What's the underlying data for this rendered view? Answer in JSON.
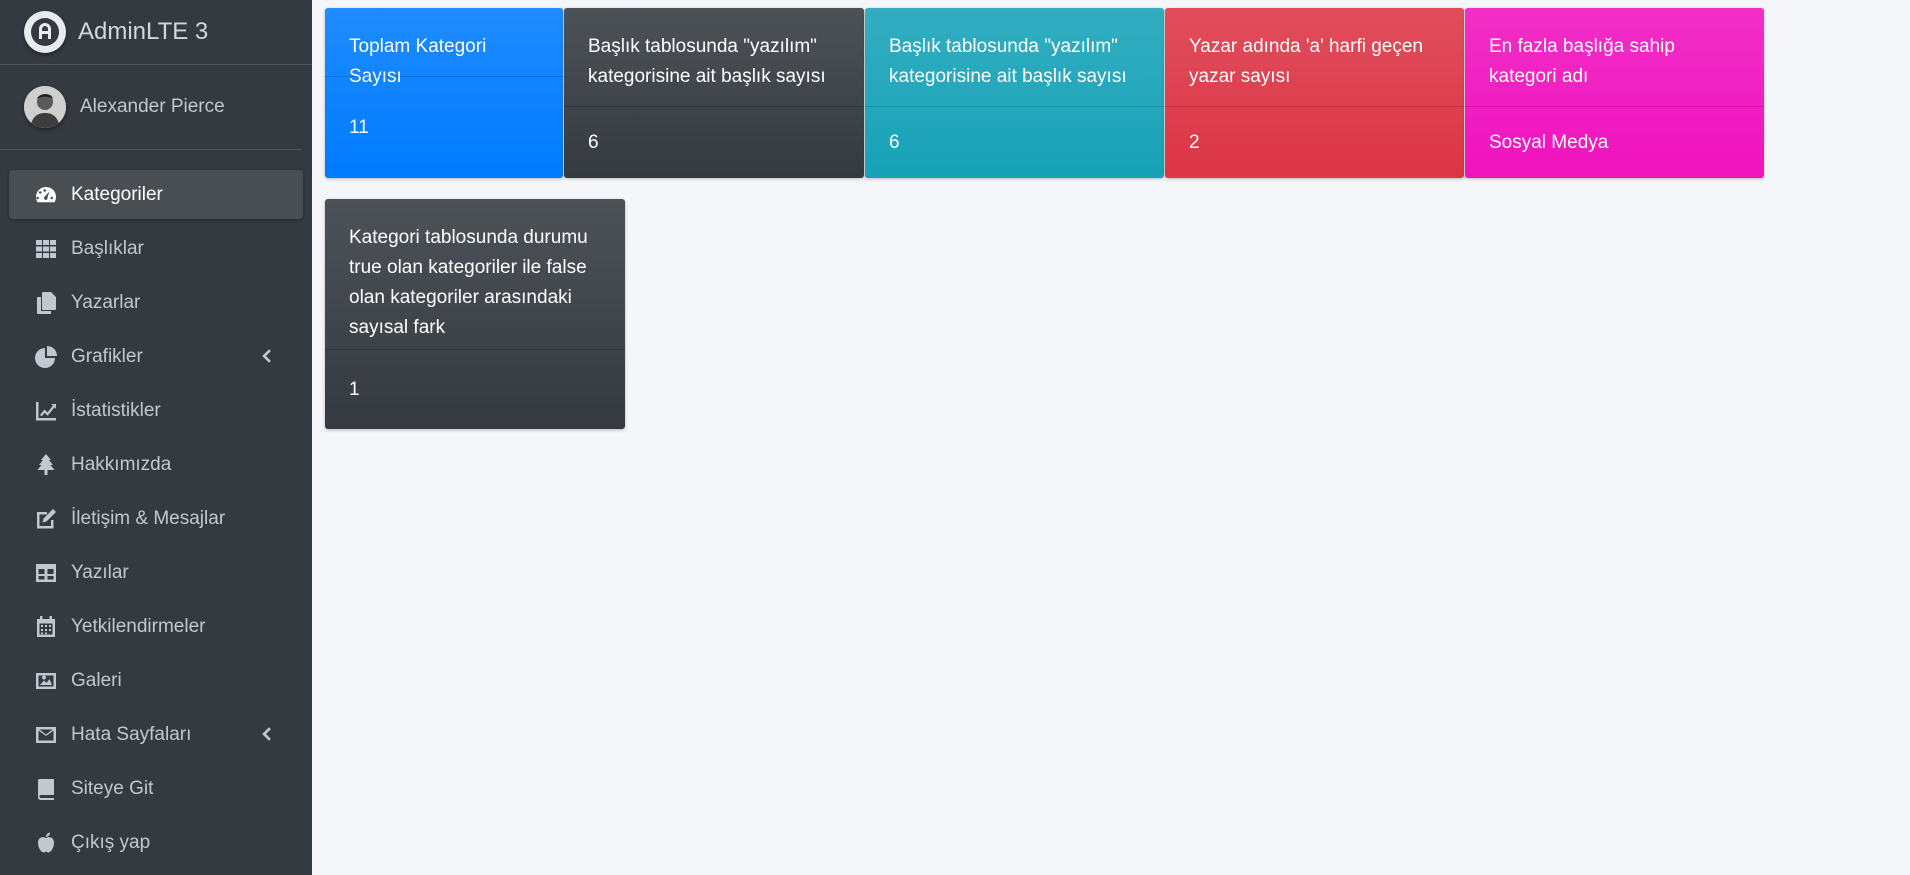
{
  "brand": {
    "title": "AdminLTE 3",
    "logo_icon": "adminlte-logo-icon"
  },
  "user": {
    "name": "Alexander Pierce"
  },
  "sidebar": {
    "items": [
      {
        "label": "Kategoriler",
        "icon": "dashboard-icon",
        "active": true
      },
      {
        "label": "Başlıklar",
        "icon": "grid-icon"
      },
      {
        "label": "Yazarlar",
        "icon": "copy-icon"
      },
      {
        "label": "Grafikler",
        "icon": "pie-chart-icon",
        "has_chevron": true
      },
      {
        "label": "İstatistikler",
        "icon": "line-chart-icon"
      },
      {
        "label": "Hakkımızda",
        "icon": "tree-icon"
      },
      {
        "label": "İletişim & Mesajlar",
        "icon": "edit-icon"
      },
      {
        "label": "Yazılar",
        "icon": "table-icon"
      },
      {
        "label": "Yetkilendirmeler",
        "icon": "calendar-icon"
      },
      {
        "label": "Galeri",
        "icon": "image-icon"
      },
      {
        "label": "Hata Sayfaları",
        "icon": "envelope-icon",
        "has_chevron": true
      },
      {
        "label": "Siteye Git",
        "icon": "book-icon"
      },
      {
        "label": "Çıkış yap",
        "icon": "apple-icon"
      }
    ]
  },
  "cards": [
    {
      "title": "Toplam Kategori Sayısı",
      "value": "11",
      "color": "#007bff"
    },
    {
      "title": "Başlık tablosunda \"yazılım\" kategorisine ait başlık sayısı",
      "value": "6",
      "color": "#343a40"
    },
    {
      "title": "Başlık tablosunda \"yazılım\" kategorisine ait başlık sayısı",
      "value": "6",
      "color": "#17a2b8"
    },
    {
      "title": "Yazar adında 'a' harfi geçen yazar sayısı",
      "value": "2",
      "color": "#dc3545"
    },
    {
      "title": "En fazla başlığa sahip kategori adı",
      "value": "Sosyal Medya",
      "color": "#f012be"
    },
    {
      "title": "Kategori tablosunda durumu true olan kategoriler ile false olan kategoriler arasındaki sayısal fark",
      "value": "1",
      "color": "#343a40"
    }
  ]
}
